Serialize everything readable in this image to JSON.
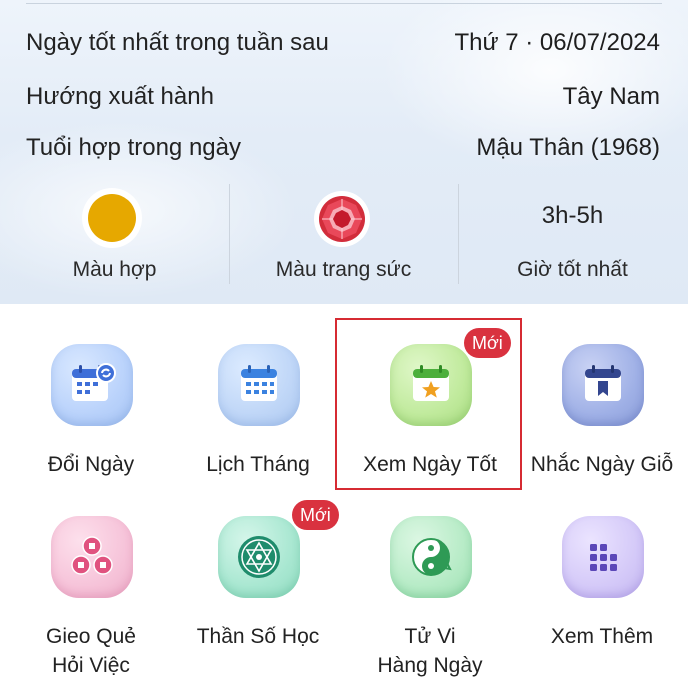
{
  "summary": {
    "rows": [
      {
        "label": "Ngày tốt nhất trong tuần sau",
        "value": "Thứ 7 · 06/07/2024"
      },
      {
        "label": "Hướng xuất hành",
        "value": "Tây Nam"
      },
      {
        "label": "Tuổi hợp trong ngày",
        "value": "Mậu Thân (1968)"
      }
    ],
    "stats": [
      {
        "label": "Màu hợp",
        "icon": "color-dot-icon",
        "color": "#e6a800"
      },
      {
        "label": "Màu trang sức",
        "icon": "ruby-gem-icon",
        "color": "#d9323f"
      },
      {
        "label": "Giờ tốt nhất",
        "value": "3h-5h"
      }
    ]
  },
  "menu": {
    "badge_new": "Mới",
    "items": [
      {
        "label": "Đổi Ngày",
        "icon": "calendar-convert-icon"
      },
      {
        "label": "Lịch Tháng",
        "icon": "calendar-month-icon"
      },
      {
        "label": "Xem Ngày Tốt",
        "icon": "calendar-star-icon",
        "badge": "Mới"
      },
      {
        "label": "Nhắc Ngày Giỗ",
        "icon": "calendar-bookmark-icon"
      },
      {
        "label_line1": "Gieo Quẻ",
        "label_line2": "Hỏi Việc",
        "icon": "coins-icon"
      },
      {
        "label": "Thần Số Học",
        "icon": "numerology-star-icon",
        "badge": "Mới"
      },
      {
        "label_line1": "Tử Vi",
        "label_line2": "Hàng Ngày",
        "icon": "yin-yang-icon"
      },
      {
        "label": "Xem Thêm",
        "icon": "grid-more-icon"
      }
    ]
  },
  "colors": {
    "accent_red": "#d62b33",
    "badge_red": "#d9323f",
    "text": "#222222"
  }
}
